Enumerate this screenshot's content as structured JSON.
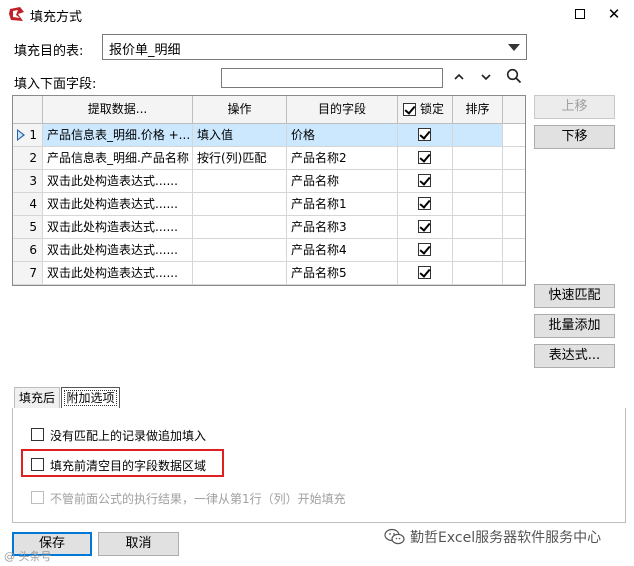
{
  "window": {
    "title": "填充方式"
  },
  "target_table": {
    "label": "填充目的表:",
    "value": "报价单_明细"
  },
  "field_entry": {
    "label": "填入下面字段:",
    "value": ""
  },
  "grid": {
    "headers": {
      "source": "提取数据...",
      "operation": "操作",
      "target": "目的字段",
      "lock": "锁定",
      "sort": "排序"
    },
    "rows": [
      {
        "num": "1",
        "source": "产品信息表_明细.价格 +...",
        "operation": "填入值",
        "target": "价格",
        "locked": true,
        "selected": true
      },
      {
        "num": "2",
        "source": "产品信息表_明细.产品名称",
        "operation": "按行(列)匹配",
        "target": "产品名称2",
        "locked": true,
        "selected": false
      },
      {
        "num": "3",
        "source": "双击此处构造表达式......",
        "operation": "",
        "target": "产品名称",
        "locked": true,
        "selected": false
      },
      {
        "num": "4",
        "source": "双击此处构造表达式......",
        "operation": "",
        "target": "产品名称1",
        "locked": true,
        "selected": false
      },
      {
        "num": "5",
        "source": "双击此处构造表达式......",
        "operation": "",
        "target": "产品名称3",
        "locked": true,
        "selected": false
      },
      {
        "num": "6",
        "source": "双击此处构造表达式......",
        "operation": "",
        "target": "产品名称4",
        "locked": true,
        "selected": false
      },
      {
        "num": "7",
        "source": "双击此处构造表达式......",
        "operation": "",
        "target": "产品名称5",
        "locked": true,
        "selected": false
      }
    ]
  },
  "side_buttons": {
    "move_up": "上移",
    "move_down": "下移",
    "quick_match": "快速匹配",
    "batch_add": "批量添加",
    "expression": "表达式..."
  },
  "tabs": {
    "after_fill": "填充后",
    "extra_options": "附加选项"
  },
  "options": {
    "append_unmatched": "没有匹配上的记录做追加填入",
    "clear_before_fill": "填充前清空目的字段数据区域",
    "start_from_first": "不管前面公式的执行结果，一律从第1行（列）开始填充"
  },
  "footer": {
    "save": "保存",
    "cancel": "取消"
  },
  "watermark": {
    "text": "勤哲Excel服务器软件服务中心",
    "small": "@ 头条号"
  },
  "colors": {
    "selection": "#cce8ff",
    "highlight": "#e02020",
    "default_button": "#0078d7"
  }
}
